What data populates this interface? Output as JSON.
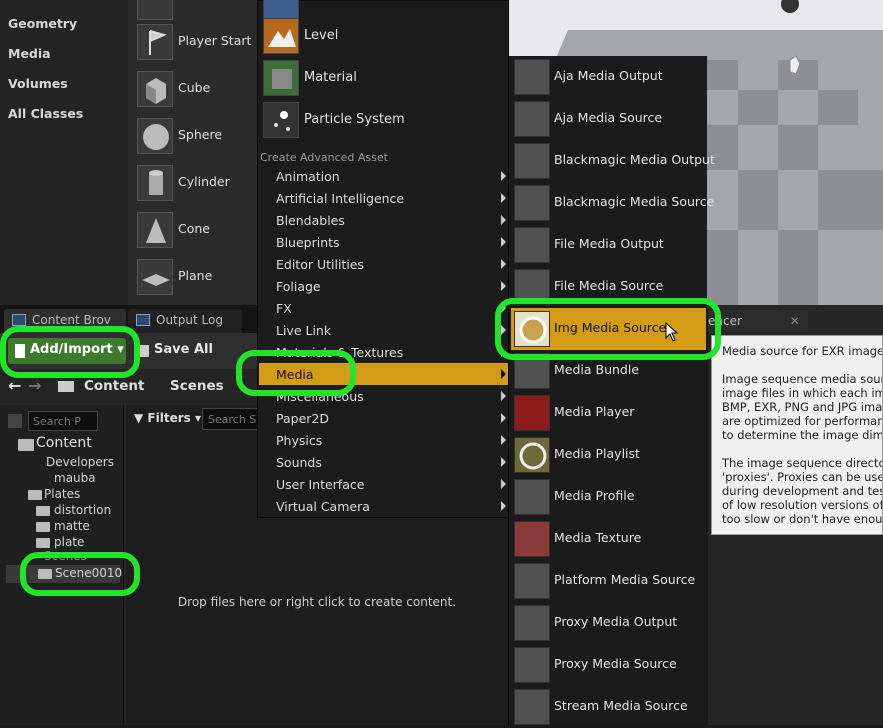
{
  "categories": [
    "Geometry",
    "Media",
    "Volumes",
    "All Classes"
  ],
  "actors": [
    "Player Start",
    "Cube",
    "Sphere",
    "Cylinder",
    "Cone",
    "Plane"
  ],
  "tabs": {
    "content_browser": "Content Brov",
    "output_log": "Output Log"
  },
  "toolbar": {
    "add_import": "Add/Import",
    "save_all": "Save All"
  },
  "path": {
    "content": "Content",
    "scenes": "Scenes"
  },
  "left_search_placeholder": "Search P",
  "tree": {
    "content": "Content",
    "developers": "Developers",
    "mauba": "mauba",
    "plates": "Plates",
    "distortion": "distortion",
    "matte": "matte",
    "plate": "plate",
    "scenes": "Scenes",
    "scene0010": "Scene0010"
  },
  "filters_label": "Filters",
  "search_placeholder": "Search S",
  "drop_message": "Drop files here or right click to create content.",
  "menu": {
    "big_items": [
      "Level",
      "Material",
      "Particle System"
    ],
    "advanced_header": "Create Advanced Asset",
    "items": [
      "Animation",
      "Artificial Intelligence",
      "Blendables",
      "Blueprints",
      "Editor Utilities",
      "Foliage",
      "FX",
      "Live Link",
      "Materials & Textures",
      "Media",
      "Miscellaneous",
      "Paper2D",
      "Physics",
      "Sounds",
      "User Interface",
      "Virtual Camera"
    ],
    "selected": "Media"
  },
  "media_submenu": {
    "items": [
      "Aja Media Output",
      "Aja Media Source",
      "Blackmagic Media Output",
      "Blackmagic Media Source",
      "File Media Output",
      "File Media Source",
      "Img Media Source",
      "Media Bundle",
      "Media Player",
      "Media Playlist",
      "Media Profile",
      "Media Texture",
      "Platform Media Source",
      "Proxy Media Output",
      "Proxy Media Source",
      "Stream Media Source"
    ],
    "selected": "Img Media Source"
  },
  "tooltip": {
    "tab": "encer",
    "lines": [
      "Media source for EXR image s",
      "",
      "Image sequence media source",
      "image files in which each imag",
      "BMP, EXR, PNG and JPG imag",
      "are optimized for performance",
      "to determine the image dimens",
      "",
      "The image sequence directory",
      "'proxies'. Proxies can be used",
      "during development and testin",
      "of low resolution versions of i",
      "too slow or don't have enough"
    ]
  },
  "colors": {
    "highlight": "#22e52a",
    "selection": "#d49b16",
    "add_button": "#3e7a2e"
  }
}
